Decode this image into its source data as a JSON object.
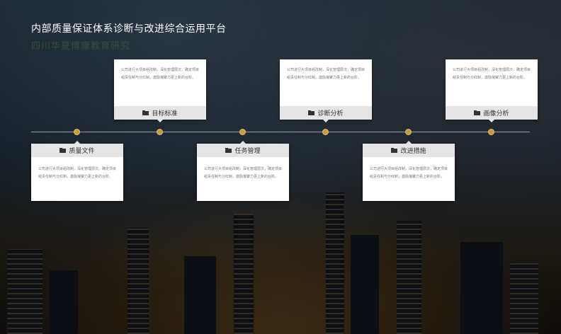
{
  "header": {
    "title": "内部质量保证体系诊断与改进综合运用平台",
    "subtitle": "四川华夏博康教育研究"
  },
  "timeline": {
    "cards": [
      {
        "label": "质量文件",
        "text": "公司进行大项目组改制，深化管理层次，确定项目组责任制与分红制，激励凝聚力更上新的台阶。"
      },
      {
        "label": "目标标准",
        "text": "公司进行大项目组改制，深化管理层次，确定项目组责任制与分红制，激励凝聚力更上新的台阶。"
      },
      {
        "label": "任务管理",
        "text": "公司进行大项目组改制，深化管理层次，确定项目组责任制与分红制，激励凝聚力更上新的台阶。"
      },
      {
        "label": "诊断分析",
        "text": "公司进行大项目组改制，深化管理层次，确定项目组责任制与分红制，激励凝聚力更上新的台阶。"
      },
      {
        "label": "改进措施",
        "text": "公司进行大项目组改制，深化管理层次，确定项目组责任制与分红制，激励凝聚力更上新的台阶。"
      },
      {
        "label": "画像分析",
        "text": "公司进行大项目组改制，深化管理层次，确定项目组责任制与分红制，激励凝聚力更上新的台阶。"
      }
    ]
  },
  "icons": {
    "card_icon": "folder-open-icon"
  },
  "colors": {
    "dot": "#c79a3a",
    "card_head": "#e5e5e5",
    "timeline": "#9aa0a8"
  }
}
